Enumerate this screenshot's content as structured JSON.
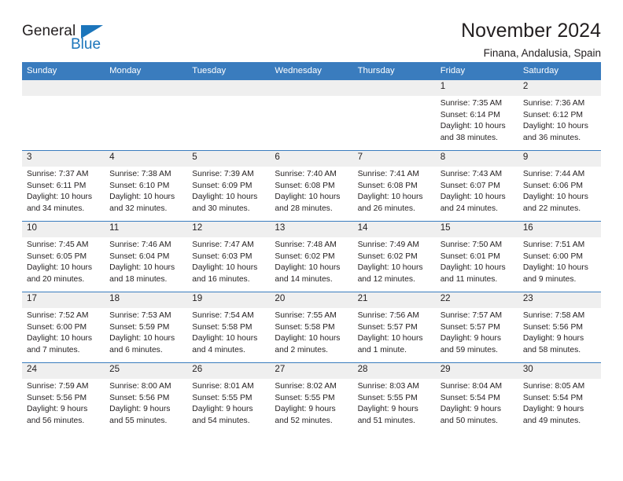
{
  "logo": {
    "word_one": "General",
    "word_two": "Blue",
    "triangle_color": "#1b75bb"
  },
  "header": {
    "title": "November 2024",
    "subtitle": "Finana, Andalusia, Spain"
  },
  "theme": {
    "header_blue": "#3a7cbe",
    "daynum_gray": "#efefef",
    "text": "#231f20"
  },
  "weekdays": [
    "Sunday",
    "Monday",
    "Tuesday",
    "Wednesday",
    "Thursday",
    "Friday",
    "Saturday"
  ],
  "weeks": [
    [
      {
        "day": "",
        "sunrise": "",
        "sunset": "",
        "daylight_a": "",
        "daylight_b": ""
      },
      {
        "day": "",
        "sunrise": "",
        "sunset": "",
        "daylight_a": "",
        "daylight_b": ""
      },
      {
        "day": "",
        "sunrise": "",
        "sunset": "",
        "daylight_a": "",
        "daylight_b": ""
      },
      {
        "day": "",
        "sunrise": "",
        "sunset": "",
        "daylight_a": "",
        "daylight_b": ""
      },
      {
        "day": "",
        "sunrise": "",
        "sunset": "",
        "daylight_a": "",
        "daylight_b": ""
      },
      {
        "day": "1",
        "sunrise": "Sunrise: 7:35 AM",
        "sunset": "Sunset: 6:14 PM",
        "daylight_a": "Daylight: 10 hours",
        "daylight_b": "and 38 minutes."
      },
      {
        "day": "2",
        "sunrise": "Sunrise: 7:36 AM",
        "sunset": "Sunset: 6:12 PM",
        "daylight_a": "Daylight: 10 hours",
        "daylight_b": "and 36 minutes."
      }
    ],
    [
      {
        "day": "3",
        "sunrise": "Sunrise: 7:37 AM",
        "sunset": "Sunset: 6:11 PM",
        "daylight_a": "Daylight: 10 hours",
        "daylight_b": "and 34 minutes."
      },
      {
        "day": "4",
        "sunrise": "Sunrise: 7:38 AM",
        "sunset": "Sunset: 6:10 PM",
        "daylight_a": "Daylight: 10 hours",
        "daylight_b": "and 32 minutes."
      },
      {
        "day": "5",
        "sunrise": "Sunrise: 7:39 AM",
        "sunset": "Sunset: 6:09 PM",
        "daylight_a": "Daylight: 10 hours",
        "daylight_b": "and 30 minutes."
      },
      {
        "day": "6",
        "sunrise": "Sunrise: 7:40 AM",
        "sunset": "Sunset: 6:08 PM",
        "daylight_a": "Daylight: 10 hours",
        "daylight_b": "and 28 minutes."
      },
      {
        "day": "7",
        "sunrise": "Sunrise: 7:41 AM",
        "sunset": "Sunset: 6:08 PM",
        "daylight_a": "Daylight: 10 hours",
        "daylight_b": "and 26 minutes."
      },
      {
        "day": "8",
        "sunrise": "Sunrise: 7:43 AM",
        "sunset": "Sunset: 6:07 PM",
        "daylight_a": "Daylight: 10 hours",
        "daylight_b": "and 24 minutes."
      },
      {
        "day": "9",
        "sunrise": "Sunrise: 7:44 AM",
        "sunset": "Sunset: 6:06 PM",
        "daylight_a": "Daylight: 10 hours",
        "daylight_b": "and 22 minutes."
      }
    ],
    [
      {
        "day": "10",
        "sunrise": "Sunrise: 7:45 AM",
        "sunset": "Sunset: 6:05 PM",
        "daylight_a": "Daylight: 10 hours",
        "daylight_b": "and 20 minutes."
      },
      {
        "day": "11",
        "sunrise": "Sunrise: 7:46 AM",
        "sunset": "Sunset: 6:04 PM",
        "daylight_a": "Daylight: 10 hours",
        "daylight_b": "and 18 minutes."
      },
      {
        "day": "12",
        "sunrise": "Sunrise: 7:47 AM",
        "sunset": "Sunset: 6:03 PM",
        "daylight_a": "Daylight: 10 hours",
        "daylight_b": "and 16 minutes."
      },
      {
        "day": "13",
        "sunrise": "Sunrise: 7:48 AM",
        "sunset": "Sunset: 6:02 PM",
        "daylight_a": "Daylight: 10 hours",
        "daylight_b": "and 14 minutes."
      },
      {
        "day": "14",
        "sunrise": "Sunrise: 7:49 AM",
        "sunset": "Sunset: 6:02 PM",
        "daylight_a": "Daylight: 10 hours",
        "daylight_b": "and 12 minutes."
      },
      {
        "day": "15",
        "sunrise": "Sunrise: 7:50 AM",
        "sunset": "Sunset: 6:01 PM",
        "daylight_a": "Daylight: 10 hours",
        "daylight_b": "and 11 minutes."
      },
      {
        "day": "16",
        "sunrise": "Sunrise: 7:51 AM",
        "sunset": "Sunset: 6:00 PM",
        "daylight_a": "Daylight: 10 hours",
        "daylight_b": "and 9 minutes."
      }
    ],
    [
      {
        "day": "17",
        "sunrise": "Sunrise: 7:52 AM",
        "sunset": "Sunset: 6:00 PM",
        "daylight_a": "Daylight: 10 hours",
        "daylight_b": "and 7 minutes."
      },
      {
        "day": "18",
        "sunrise": "Sunrise: 7:53 AM",
        "sunset": "Sunset: 5:59 PM",
        "daylight_a": "Daylight: 10 hours",
        "daylight_b": "and 6 minutes."
      },
      {
        "day": "19",
        "sunrise": "Sunrise: 7:54 AM",
        "sunset": "Sunset: 5:58 PM",
        "daylight_a": "Daylight: 10 hours",
        "daylight_b": "and 4 minutes."
      },
      {
        "day": "20",
        "sunrise": "Sunrise: 7:55 AM",
        "sunset": "Sunset: 5:58 PM",
        "daylight_a": "Daylight: 10 hours",
        "daylight_b": "and 2 minutes."
      },
      {
        "day": "21",
        "sunrise": "Sunrise: 7:56 AM",
        "sunset": "Sunset: 5:57 PM",
        "daylight_a": "Daylight: 10 hours",
        "daylight_b": "and 1 minute."
      },
      {
        "day": "22",
        "sunrise": "Sunrise: 7:57 AM",
        "sunset": "Sunset: 5:57 PM",
        "daylight_a": "Daylight: 9 hours",
        "daylight_b": "and 59 minutes."
      },
      {
        "day": "23",
        "sunrise": "Sunrise: 7:58 AM",
        "sunset": "Sunset: 5:56 PM",
        "daylight_a": "Daylight: 9 hours",
        "daylight_b": "and 58 minutes."
      }
    ],
    [
      {
        "day": "24",
        "sunrise": "Sunrise: 7:59 AM",
        "sunset": "Sunset: 5:56 PM",
        "daylight_a": "Daylight: 9 hours",
        "daylight_b": "and 56 minutes."
      },
      {
        "day": "25",
        "sunrise": "Sunrise: 8:00 AM",
        "sunset": "Sunset: 5:56 PM",
        "daylight_a": "Daylight: 9 hours",
        "daylight_b": "and 55 minutes."
      },
      {
        "day": "26",
        "sunrise": "Sunrise: 8:01 AM",
        "sunset": "Sunset: 5:55 PM",
        "daylight_a": "Daylight: 9 hours",
        "daylight_b": "and 54 minutes."
      },
      {
        "day": "27",
        "sunrise": "Sunrise: 8:02 AM",
        "sunset": "Sunset: 5:55 PM",
        "daylight_a": "Daylight: 9 hours",
        "daylight_b": "and 52 minutes."
      },
      {
        "day": "28",
        "sunrise": "Sunrise: 8:03 AM",
        "sunset": "Sunset: 5:55 PM",
        "daylight_a": "Daylight: 9 hours",
        "daylight_b": "and 51 minutes."
      },
      {
        "day": "29",
        "sunrise": "Sunrise: 8:04 AM",
        "sunset": "Sunset: 5:54 PM",
        "daylight_a": "Daylight: 9 hours",
        "daylight_b": "and 50 minutes."
      },
      {
        "day": "30",
        "sunrise": "Sunrise: 8:05 AM",
        "sunset": "Sunset: 5:54 PM",
        "daylight_a": "Daylight: 9 hours",
        "daylight_b": "and 49 minutes."
      }
    ]
  ]
}
